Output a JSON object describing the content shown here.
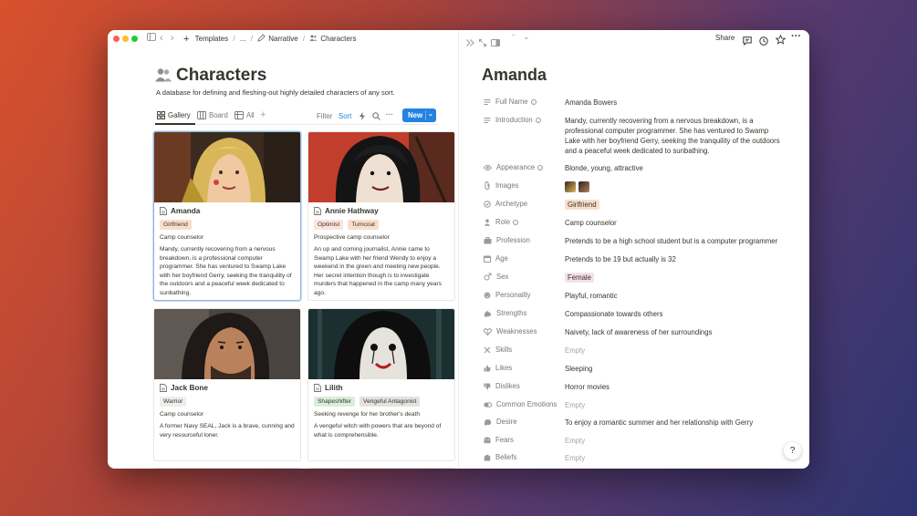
{
  "colors": {
    "accent": "#2383e2",
    "window_bg": "#ffffff",
    "text": "#37352f",
    "muted": "#787774"
  },
  "breadcrumb": {
    "items": [
      "Templates",
      "...",
      "Narrative",
      "Characters"
    ],
    "sep": "/"
  },
  "page": {
    "title": "Characters",
    "description": "A database for defining and fleshing-out highly detailed characters of any sort."
  },
  "views": {
    "tabs": [
      {
        "label": "Gallery"
      },
      {
        "label": "Board"
      },
      {
        "label": "All"
      }
    ],
    "add": "+",
    "filter": "Filter",
    "sort": "Sort",
    "more": "···",
    "new_label": "New"
  },
  "cards": [
    {
      "name": "Amanda",
      "tags": [
        {
          "label": "Girlfriend",
          "color": "#fadec9"
        }
      ],
      "role": "Camp counselor",
      "text": "Mandy, currently recovering from a nervous breakdown, is a professional computer programmer. She has ventured to Swamp Lake with her boyfriend Gerry, seeking the tranquility of the outdoors and a peaceful week dedicated to sunbathing."
    },
    {
      "name": "Annie Hathway",
      "tags": [
        {
          "label": "Optimist",
          "color": "#ffe2dd"
        },
        {
          "label": "Turncoat",
          "color": "#fadec9"
        }
      ],
      "role": "Prospective camp counselor",
      "text": "An up and coming journalist, Annie came to Swamp Lake with her friend Wendy to enjoy a weekend in the green and meeting new people. Her secret intention though is to investigate murders that happened in the camp many years ago."
    },
    {
      "name": "Jack Bone",
      "tags": [
        {
          "label": "Warrior",
          "color": "#eeeeec"
        }
      ],
      "role": "Camp counselor",
      "text": "A former Navy SEAL, Jack is a brave, cunning and very resourceful loner."
    },
    {
      "name": "Lilith",
      "tags": [
        {
          "label": "Shapeshifter",
          "color": "#dbeddb"
        },
        {
          "label": "Vengeful Antagonist",
          "color": "#e3e2e0"
        }
      ],
      "role": "Seeking revenge for her brother's death",
      "text": "A vengeful witch with powers that are beyond of what is comprehensible."
    }
  ],
  "topbar_right": {
    "share": "Share"
  },
  "detail": {
    "title": "Amanda",
    "properties": [
      {
        "label": "Full Name",
        "value": "Amanda Bowers",
        "info": true,
        "icon": "text-icon"
      },
      {
        "label": "Introduction",
        "value": "Mandy, currently recovering from a nervous breakdown, is a professional computer programmer. She has ventured to Swamp Lake with her boyfriend Gerry, seeking the tranquility of the outdoors and a peaceful week dedicated to sunbathing.",
        "info": true,
        "icon": "text-icon"
      },
      {
        "label": "Appearance",
        "value": "Blonde, young, attractive",
        "info": true,
        "icon": "eye-icon"
      },
      {
        "label": "Images",
        "value": "",
        "icon": "paperclip-icon"
      },
      {
        "label": "Archetype",
        "value": "Girlfriend",
        "tag_color": "#fadec9",
        "icon": "archetype-icon"
      },
      {
        "label": "Role",
        "value": "Camp counselor",
        "info": true,
        "icon": "role-icon"
      },
      {
        "label": "Profession",
        "value": "Pretends to be a high school student but is a computer programmer",
        "icon": "briefcase-icon"
      },
      {
        "label": "Age",
        "value": "Pretends to be 19 but actually is 32",
        "icon": "calendar-icon"
      },
      {
        "label": "Sex",
        "value": "Female",
        "tag_color": "#f5e0e9",
        "icon": "sex-icon"
      },
      {
        "label": "Personailty",
        "value": "Playful, romantic",
        "icon": "personality-icon"
      },
      {
        "label": "Strengths",
        "value": "Compassionate towards others",
        "icon": "strength-icon"
      },
      {
        "label": "Weaknesses",
        "value": "Naivety, lack of awareness of her surroundings",
        "icon": "weakness-icon"
      },
      {
        "label": "Skills",
        "value": "Empty",
        "empty": true,
        "icon": "skills-icon"
      },
      {
        "label": "Likes",
        "value": "Sleeping",
        "icon": "thumbs-up-icon"
      },
      {
        "label": "Dislikes",
        "value": "Horror movies",
        "icon": "thumbs-down-icon"
      },
      {
        "label": "Common Emotions",
        "value": "Empty",
        "empty": true,
        "icon": "emotion-icon"
      },
      {
        "label": "Desire",
        "value": "To enjoy a romantic summer and her relationship with Gerry",
        "icon": "desire-icon"
      },
      {
        "label": "Fears",
        "value": "Empty",
        "empty": true,
        "icon": "fear-icon"
      },
      {
        "label": "Beliefs",
        "value": "Empty",
        "empty": true,
        "icon": "belief-icon"
      }
    ]
  },
  "help": "?"
}
